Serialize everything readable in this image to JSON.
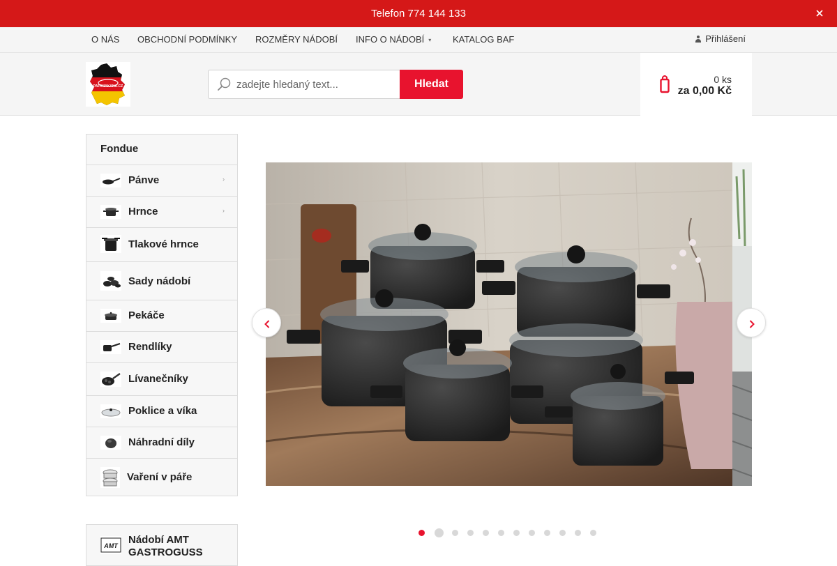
{
  "topbar": {
    "phone_text": "Telefon 774 144 133",
    "close_icon": "close-icon"
  },
  "nav": {
    "items": [
      {
        "label": "O NÁS"
      },
      {
        "label": "OBCHODNÍ PODMÍNKY"
      },
      {
        "label": "ROZMĚRY NÁDOBÍ"
      },
      {
        "label": "INFO O NÁDOBÍ",
        "has_dropdown": true
      },
      {
        "label": "KATALOG BAF"
      }
    ],
    "login_label": "Přihlášení"
  },
  "header": {
    "logo_text": "PAPINIAKANA.CZ",
    "search": {
      "placeholder": "zadejte hledaný text...",
      "button_label": "Hledat"
    },
    "cart": {
      "count": "0 ks",
      "total": "za 0,00 Kč"
    }
  },
  "sidebar": {
    "heading": "Fondue",
    "items": [
      {
        "label": "Pánve",
        "icon": "frying-pan-icon",
        "has_submenu": true
      },
      {
        "label": "Hrnce",
        "icon": "pot-icon",
        "has_submenu": true
      },
      {
        "label": "Tlakové hrnce",
        "icon": "pressure-cooker-icon",
        "has_submenu": false
      },
      {
        "label": "Sady nádobí",
        "icon": "cookware-set-icon",
        "has_submenu": false
      },
      {
        "label": "Pekáče",
        "icon": "roaster-icon",
        "has_submenu": false
      },
      {
        "label": "Rendlíky",
        "icon": "saucepan-icon",
        "has_submenu": false
      },
      {
        "label": "Lívanečníky",
        "icon": "pancake-pan-icon",
        "has_submenu": false
      },
      {
        "label": "Poklice a víka",
        "icon": "lid-icon",
        "has_submenu": false
      },
      {
        "label": "Náhradní díly",
        "icon": "spare-part-icon",
        "has_submenu": false
      },
      {
        "label": "Vaření v páře",
        "icon": "steamer-icon",
        "has_submenu": false
      }
    ],
    "brand_box": {
      "label_line1": "Nádobí AMT",
      "label_line2": "GASTROGUSS",
      "icon": "amt-logo-icon"
    }
  },
  "slider": {
    "slide_count": 12,
    "active_index": 0,
    "prev_icon": "chevron-left-icon",
    "next_icon": "chevron-right-icon"
  },
  "colors": {
    "brand_red": "#d51818",
    "accent_red": "#e8132e"
  }
}
